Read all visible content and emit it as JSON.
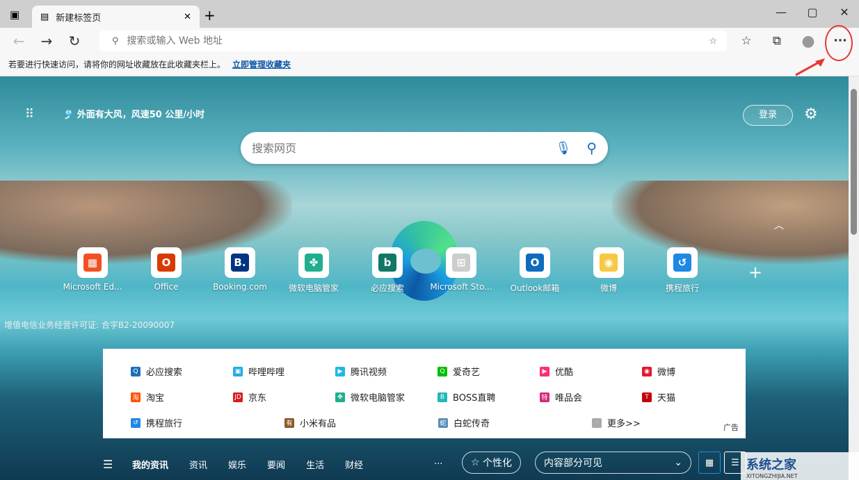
{
  "tab": {
    "title": "新建标签页"
  },
  "toolbar": {
    "address_placeholder": "搜索或输入 Web 地址",
    "more_label": "···"
  },
  "favbar": {
    "message": "若要进行快速访问，请将你的网址收藏放在此收藏夹栏上。",
    "link": "立即管理收藏夹"
  },
  "page": {
    "weather": "外面有大风，风速50 公里/小时",
    "login": "登录",
    "search_placeholder": "搜索网页",
    "icp": "增值电信业务经营许可证: 合字B2-20090007"
  },
  "tiles": [
    {
      "label": "Microsoft Ed...",
      "color": "#f25022",
      "glyph": "▦"
    },
    {
      "label": "Office",
      "color": "#d83b01",
      "glyph": "O"
    },
    {
      "label": "Booking.com",
      "color": "#003580",
      "glyph": "B."
    },
    {
      "label": "微软电脑管家",
      "color": "#1fae8f",
      "glyph": "✤"
    },
    {
      "label": "必应搜索",
      "color": "#117865",
      "glyph": "b"
    },
    {
      "label": "Microsoft Sto...",
      "color": "#cccccc",
      "glyph": "⊞"
    },
    {
      "label": "Outlook邮箱",
      "color": "#0f6cbd",
      "glyph": "O"
    },
    {
      "label": "微博",
      "color": "#f7c843",
      "glyph": "◉"
    },
    {
      "label": "携程旅行",
      "color": "#1e88e5",
      "glyph": "↺"
    }
  ],
  "links": [
    [
      {
        "label": "必应搜索",
        "color": "#1d6fb8",
        "glyph": "Q"
      },
      {
        "label": "哔哩哔哩",
        "color": "#23ade5",
        "glyph": "▣"
      },
      {
        "label": "腾讯视频",
        "color": "#20b8e5",
        "glyph": "▶"
      },
      {
        "label": "爱奇艺",
        "color": "#00be06",
        "glyph": "Q"
      },
      {
        "label": "优酷",
        "color": "#ff2d7a",
        "glyph": "▶"
      },
      {
        "label": "微博",
        "color": "#e6162d",
        "glyph": "◉"
      }
    ],
    [
      {
        "label": "淘宝",
        "color": "#ff5000",
        "glyph": "淘"
      },
      {
        "label": "京东",
        "color": "#d71c1e",
        "glyph": "JD"
      },
      {
        "label": "微软电脑管家",
        "color": "#1fae8f",
        "glyph": "✤"
      },
      {
        "label": "BOSS直聘",
        "color": "#25b6b6",
        "glyph": "B"
      },
      {
        "label": "唯品会",
        "color": "#d6287e",
        "glyph": "特"
      },
      {
        "label": "天猫",
        "color": "#c4000b",
        "glyph": "T"
      }
    ],
    [
      {
        "label": "携程旅行",
        "color": "#1e88e5",
        "glyph": "↺"
      },
      {
        "label": "小米有品",
        "color": "#8b5a2b",
        "glyph": "有"
      },
      {
        "label": "白蛇传奇",
        "color": "#5b8fb8",
        "glyph": "蛇"
      },
      {
        "label": "更多>>",
        "color": "#aaaaaa",
        "glyph": "·"
      }
    ]
  ],
  "ad_label": "广告",
  "feed": {
    "mine": "我的资讯",
    "tabs": [
      "资讯",
      "娱乐",
      "要闻",
      "生活",
      "财经"
    ],
    "more": "···",
    "personalize": "个性化",
    "visibility": "内容部分可见"
  },
  "watermark": {
    "name": "系统之家",
    "url": "XITONGZHIJIA.NET"
  }
}
